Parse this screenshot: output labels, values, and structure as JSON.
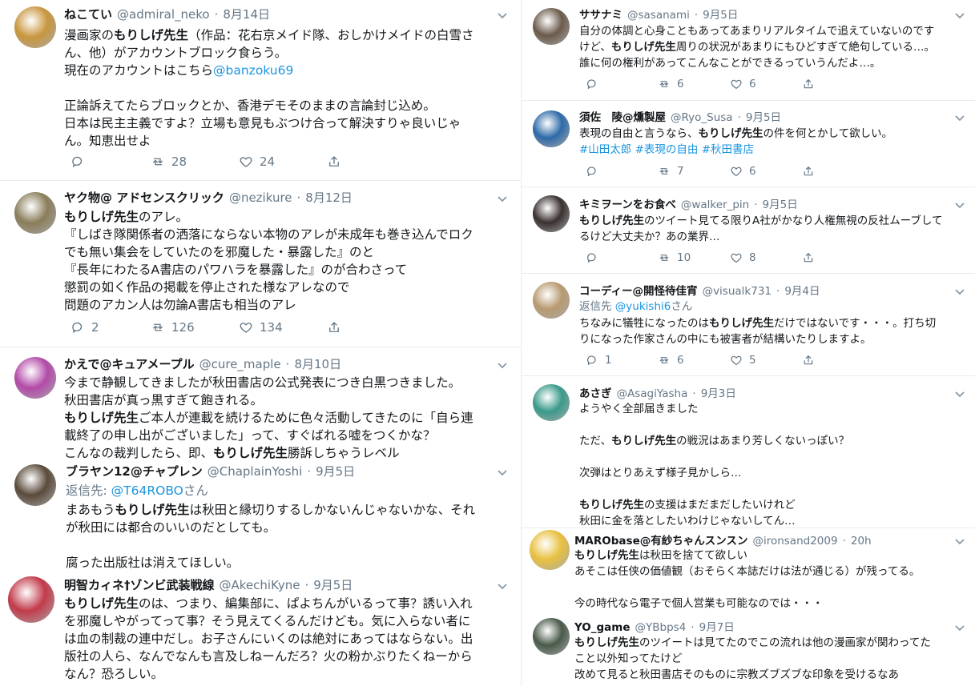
{
  "left": {
    "tweets": [
      {
        "name": "ねこてい",
        "handle": "@admiral_neko",
        "dot": "·",
        "time": "8月14日",
        "avatar_color": "#c8963e",
        "lines": [
          [
            {
              "t": "漫画家の"
            },
            {
              "t": "もりしげ先生",
              "b": true
            },
            {
              "t": "（作品：花右京メイド隊、おしかけメイドの白雪さ"
            }
          ],
          [
            {
              "t": "ん、他）がアカウントブロック食らう。"
            }
          ],
          [
            {
              "t": "現在のアカウントはこちら"
            },
            {
              "t": "@banzoku69",
              "m": true
            }
          ],
          [
            {
              "t": ""
            }
          ],
          [
            {
              "t": "正論訴えてたらブロックとか、香港デモそのままの言論封じ込め。"
            }
          ],
          [
            {
              "t": "日本は民主主義ですよ？立場も意見もぶつけ合って解決すりゃ良いじゃ"
            }
          ],
          [
            {
              "t": "ん。知恵出せよ"
            }
          ]
        ],
        "reply": "",
        "retweet": "28",
        "like": "24"
      },
      {
        "name": "ヤク物@ アドセンスクリック",
        "handle": "@nezikure",
        "dot": "·",
        "time": "8月12日",
        "avatar_color": "#8a7d5a",
        "lines": [
          [
            {
              "t": "もりしげ先生",
              "b": true
            },
            {
              "t": "のアレ。"
            }
          ],
          [
            {
              "t": "『しばき隊関係者の洒落にならない本物のアレが未成年も巻き込んでロク"
            }
          ],
          [
            {
              "t": "でも無い集会をしていたのを邪魔した・暴露した』のと"
            }
          ],
          [
            {
              "t": "『長年にわたるA書店のパワハラを暴露した』のが合わさって"
            }
          ],
          [
            {
              "t": "懲罰の如く作品の掲載を停止された様なアレなので"
            }
          ],
          [
            {
              "t": "問題のアカン人は勿論A書店も相当のアレ"
            }
          ]
        ],
        "reply": "2",
        "retweet": "126",
        "like": "134"
      },
      {
        "name": "かえで@キュアメープル",
        "handle": "@cure_maple",
        "dot": "·",
        "time": "8月10日",
        "avatar_color": "#b24aa8",
        "lines": [
          [
            {
              "t": "今まで静観してきましたが秋田書店の公式発表につき白黒つきました。"
            }
          ],
          [
            {
              "t": "秋田書店が真っ黒すぎて飽きれる。"
            }
          ],
          [
            {
              "t": "もりしげ先生",
              "b": true
            },
            {
              "t": "ご本人が連載を続けるために色々活動してきたのに「自ら連"
            }
          ],
          [
            {
              "t": "載終了の申し出がございました」って、すぐばれる嘘をつくかな？"
            }
          ],
          [
            {
              "t": "こんなの裁判したら、即、"
            },
            {
              "t": "もりしげ先生",
              "b": true
            },
            {
              "t": "勝訴しちゃうレベル"
            }
          ]
        ]
      },
      {
        "name": "ブラヤン12@チャプレン",
        "handle": "@ChaplainYoshi",
        "dot": "·",
        "time": "9月5日",
        "avatar_color": "#5a4a3a",
        "replying_label": "返信先: ",
        "replying_to": "@T64ROBO",
        "replying_suffix": "さん",
        "lines": [
          [
            {
              "t": "まあもう"
            },
            {
              "t": "もりしげ先生",
              "b": true
            },
            {
              "t": "は秋田と縁切りするしかないんじゃないかな、それ"
            }
          ],
          [
            {
              "t": "が秋田には都合のいいのだとしても。"
            }
          ],
          [
            {
              "t": ""
            }
          ],
          [
            {
              "t": "腐った出版社は消えてほしい。"
            }
          ]
        ]
      },
      {
        "name": "明智カィネ†ゾンビ武装戦線",
        "handle": "@AkechiKyne",
        "dot": "·",
        "time": "9月5日",
        "avatar_color": "#c23a4a",
        "lines": [
          [
            {
              "t": "もりしげ先生",
              "b": true
            },
            {
              "t": "のは、つまり、編集部に、ぱよちんがいるって事？誘い入れ"
            }
          ],
          [
            {
              "t": "を邪魔しやがってって事？そう見えてくるんだけども。気に入らない者に"
            }
          ],
          [
            {
              "t": "は血の制裁の連中だし。お子さんにいくのは絶対にあってはならない。出"
            }
          ],
          [
            {
              "t": "版社の人ら、なんでなんも言及しねーんだろ？火の粉かぶりたくねーから"
            }
          ],
          [
            {
              "t": "なん？恐ろしい。"
            }
          ]
        ]
      }
    ]
  },
  "right": {
    "tweets": [
      {
        "name": "ササナミ",
        "handle": "@sasanami",
        "dot": "·",
        "time": "9月5日",
        "avatar_color": "#6b5b4b",
        "lines": [
          [
            {
              "t": "自分の体調と心身こともあってあまりリアルタイムで追えていないのです"
            }
          ],
          [
            {
              "t": "けど、"
            },
            {
              "t": "もりしげ先生",
              "b": true
            },
            {
              "t": "周りの状況があまりにもひどすぎて絶句している…。"
            }
          ],
          [
            {
              "t": "誰に何の権利があってこんなことができるっていうんだよ…。"
            }
          ]
        ],
        "reply": "",
        "retweet": "6",
        "like": "6"
      },
      {
        "name": "須佐　陵@燻製屋",
        "handle": "@Ryo_Susa",
        "dot": "·",
        "time": "9月5日",
        "avatar_color": "#2e6aa8",
        "lines": [
          [
            {
              "t": "表現の自由と言うなら、"
            },
            {
              "t": "もりしげ先生",
              "b": true
            },
            {
              "t": "の件を何とかして欲しい。"
            }
          ],
          [
            {
              "t": "#山田太郎",
              "m": true
            },
            {
              "t": " "
            },
            {
              "t": "#表現の自由",
              "m": true
            },
            {
              "t": " "
            },
            {
              "t": "#秋田書店",
              "m": true
            }
          ]
        ],
        "reply": "",
        "retweet": "7",
        "like": "6"
      },
      {
        "name": "キミヲーンをお食べ",
        "handle": "@walker_pin",
        "dot": "·",
        "time": "9月5日",
        "avatar_color": "#3a3030",
        "lines": [
          [
            {
              "t": "もりしげ先生",
              "b": true
            },
            {
              "t": "のツイート見てる限りA社がかなり人権無視の反社ムーブして"
            }
          ],
          [
            {
              "t": "るけど大丈夫か？あの業界…"
            }
          ]
        ],
        "reply": "",
        "retweet": "10",
        "like": "8"
      },
      {
        "name": "コーディー@開怪待佳宵",
        "handle": "@visualk731",
        "dot": "·",
        "time": "9月4日",
        "avatar_color": "#b89a70",
        "replying_label": "返信先 ",
        "replying_to": "@yukishi6",
        "replying_suffix": "さん",
        "lines": [
          [
            {
              "t": "ちなみに犠牲になったのは"
            },
            {
              "t": "もりしげ先生",
              "b": true
            },
            {
              "t": "だけではないです・・・。打ち切"
            }
          ],
          [
            {
              "t": "りになった作家さんの中にも被害者が結構いたりしますよ。"
            }
          ]
        ],
        "reply": "1",
        "retweet": "6",
        "like": "5"
      },
      {
        "name": "あさぎ",
        "handle": "@AsagiYasha",
        "dot": "·",
        "time": "9月3日",
        "avatar_color": "#3a9a8a",
        "lines": [
          [
            {
              "t": "ようやく全部届きました"
            }
          ],
          [
            {
              "t": ""
            }
          ],
          [
            {
              "t": "ただ、"
            },
            {
              "t": "もりしげ先生",
              "b": true
            },
            {
              "t": "の戦況はあまり芳しくないっぽい？"
            }
          ],
          [
            {
              "t": ""
            }
          ],
          [
            {
              "t": "次弾はとりあえず様子見かしら…"
            }
          ],
          [
            {
              "t": ""
            }
          ],
          [
            {
              "t": "もりしげ先生",
              "b": true
            },
            {
              "t": "の支援はまだまだしたいけれど"
            }
          ],
          [
            {
              "t": "秋田に金を落としたいわけじゃないしてん…"
            }
          ]
        ]
      },
      {
        "name": "MARObase@有紗ちゃんスンスン",
        "handle": "@ironsand2009",
        "dot": "·",
        "time": "20h",
        "avatar_color": "#e8c040",
        "lines": [
          [
            {
              "t": "もりしげ先生",
              "b": true
            },
            {
              "t": "は秋田を捨てて欲しい"
            }
          ],
          [
            {
              "t": "あそこは任侠の価値観（おそらく本誌だけは法が通じる）が残ってる。"
            }
          ],
          [
            {
              "t": ""
            }
          ],
          [
            {
              "t": "今の時代なら電子で個人営業も可能なのでは・・・"
            }
          ]
        ]
      },
      {
        "name": "YO_game",
        "handle": "@YBbps4",
        "dot": "·",
        "time": "9月7日",
        "avatar_color": "#4a5a4a",
        "lines": [
          [
            {
              "t": "もりしげ先生",
              "b": true
            },
            {
              "t": "のツイートは見てたのでこの流れは他の漫画家が関わってた"
            }
          ],
          [
            {
              "t": "こと以外知ってたけど"
            }
          ],
          [
            {
              "t": "改めて見ると秋田書店そのものに宗教ズブズブな印象を受けるなあ"
            }
          ]
        ]
      }
    ]
  },
  "icons": {
    "reply": "reply-icon",
    "retweet": "retweet-icon",
    "like": "heart-icon",
    "share": "share-icon",
    "caret": "chevron-down-icon"
  },
  "colors": {
    "mention": "#1b95e0",
    "muted": "#657786",
    "text": "#14171a"
  }
}
